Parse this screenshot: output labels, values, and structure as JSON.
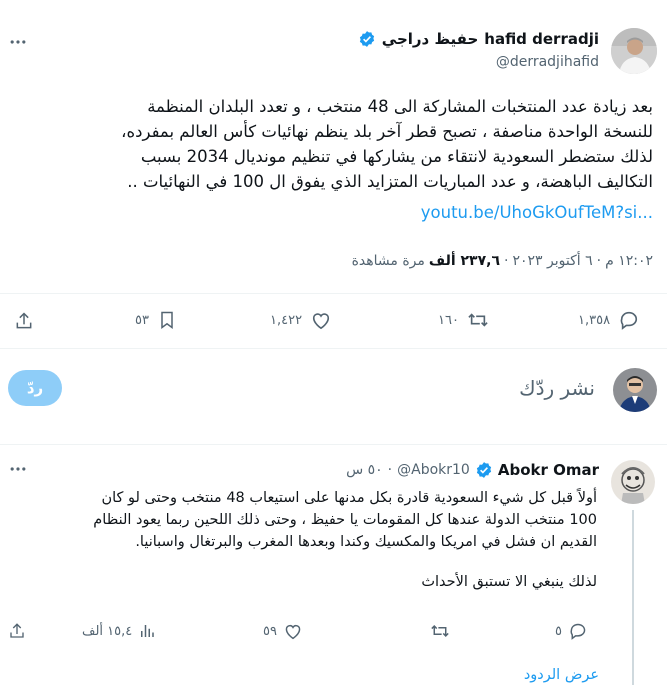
{
  "tweet": {
    "author_name": "hafid derradji",
    "author_name_ar": "حفيظ دراجي",
    "handle": "@derradjihafid",
    "text_lines": [
      "بعد زيادة عدد المنتخبات المشاركة الى 48 منتخب ، و تعدد البلدان المنظمة",
      "للنسخة الواحدة مناصفة ، تصبح قطر آخر بلد ينظم نهائيات كأس العالم بمفرده،",
      "لذلك ستضطر السعودية لانتقاء من يشاركها في تنظيم مونديال 2034 بسبب",
      "التكاليف الباهضة، و عدد المباريات المتزايد الذي يفوق ال 100 في النهائيات  .."
    ],
    "link": "youtu.be/UhoGkOufTeM?si...",
    "time": "١٢:٠٢ م",
    "date": "٦ أكتوبر ٢٠٢٣",
    "views_count": "٢٣٧,٦ ألف",
    "views_label": "مرة مشاهدة",
    "stats": {
      "replies": "١,٣٥٨",
      "retweets": "١٦٠",
      "likes": "١,٤٢٢",
      "bookmarks": "٥٣"
    }
  },
  "compose": {
    "placeholder": "نشر ردّك",
    "reply_button": "ردّ"
  },
  "reply": {
    "author_name": "Abokr Omar",
    "handle": "@Abokr10",
    "time": "٥٠ س",
    "text_lines": [
      "أولاً قبل كل شيء السعودية قادرة بكل مدنها على استيعاب 48 منتخب وحتى لو كان",
      "100 منتخب الدولة عندها كل المقومات يا حفيظ ، وحتى ذلك اللحين ربما يعود النظام",
      "القديم ان فشل في امريكا والمكسيك وكندا وبعدها المغرب والبرتغال واسبانيا."
    ],
    "text_last": "لذلك ينبغي الا تستبق الأحداث",
    "stats": {
      "replies": "٥",
      "likes": "٥٩",
      "views": "١٥,٤ ألف"
    },
    "show_replies": "عرض الردود"
  },
  "colors": {
    "accent": "#1d9bf0",
    "reply_button_disabled": "#8ecdf8",
    "text": "#0f1419",
    "muted": "#536471"
  },
  "icons": [
    "more-icon",
    "verified-icon",
    "share-icon",
    "bookmark-icon",
    "heart-icon",
    "retweet-icon",
    "comment-icon",
    "analytics-icon"
  ]
}
